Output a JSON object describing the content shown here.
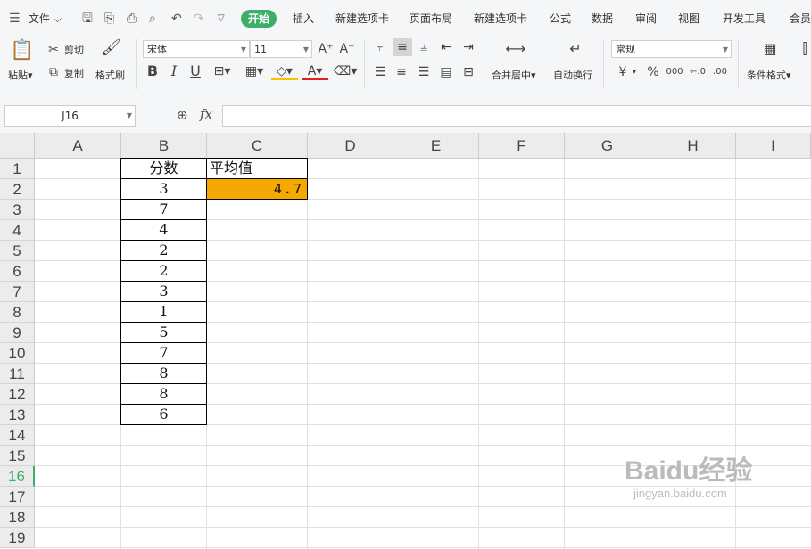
{
  "menubar": {
    "file_label": "文件",
    "tabs": [
      "开始",
      "插入",
      "新建选项卡",
      "页面布局",
      "新建选项卡",
      "公式",
      "数据",
      "审阅",
      "视图",
      "开发工具",
      "会员"
    ]
  },
  "ribbon": {
    "paste_label": "粘贴",
    "cut_label": "剪切",
    "copy_label": "复制",
    "format_painter_label": "格式刷",
    "font_name": "宋体",
    "font_size": "11",
    "merge_label": "合并居中",
    "wrap_label": "自动换行",
    "number_format": "常规",
    "currency_symbol": "¥",
    "percent_symbol": "%",
    "thousands_symbol": "000",
    "conditional_label": "条件格式"
  },
  "formula_bar": {
    "cell_ref": "J16",
    "fx_label": "fx",
    "content": ""
  },
  "grid": {
    "columns": [
      "A",
      "B",
      "C",
      "D",
      "E",
      "F",
      "G",
      "H",
      "I"
    ],
    "rows": [
      "1",
      "2",
      "3",
      "4",
      "5",
      "6",
      "7",
      "8",
      "9",
      "10",
      "11",
      "12",
      "13",
      "14",
      "15",
      "16",
      "17",
      "18",
      "19"
    ],
    "selected_row": "16",
    "header_b": "分数",
    "header_c": "平均值",
    "scores": [
      "3",
      "7",
      "4",
      "2",
      "2",
      "3",
      "1",
      "5",
      "7",
      "8",
      "8",
      "6"
    ],
    "average": "4.7",
    "highlight_color": "#f5a800"
  },
  "watermark": {
    "main": "Baidu经验",
    "sub": "jingyan.baidu.com"
  }
}
